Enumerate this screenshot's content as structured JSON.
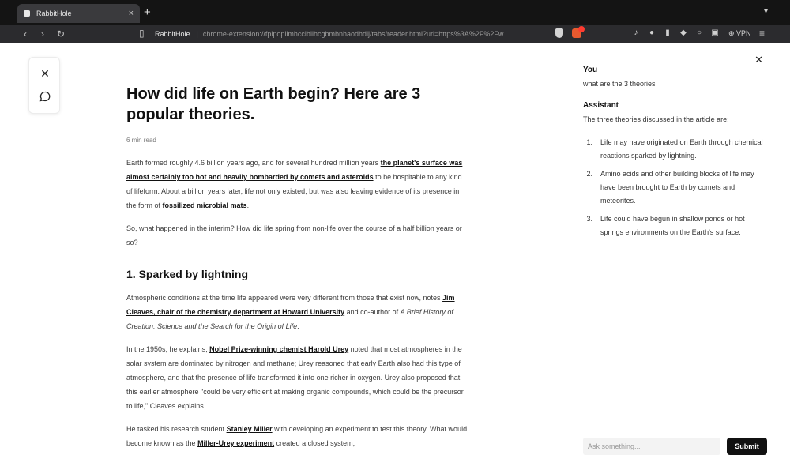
{
  "browser": {
    "tab": {
      "title": "RabbitHole",
      "close_glyph": "×"
    },
    "new_tab_glyph": "+",
    "url": {
      "site": "RabbitHole",
      "separator": "|",
      "path": "chrome-extension://fpipoplimhccibiihcgbmbnhaodhdlj/tabs/reader.html?url=https%3A%2F%2Fw..."
    },
    "vpn_label": "VPN",
    "icons": [
      "back-icon",
      "forward-icon",
      "reload-icon",
      "bookmark-icon",
      "brave-shield-icon",
      "brave-rewards-icon",
      "extension-icon",
      "menu-icon"
    ]
  },
  "reader": {
    "tools": {
      "close_icon": "✕",
      "chat_icon": "💬"
    },
    "article": {
      "title": "How did life on Earth begin? Here are 3 popular theories.",
      "read_time": "6 min read",
      "p1": {
        "t1": "Earth formed roughly 4.6 billion years ago, and for several hundred million years ",
        "l1": "the planet's surface was almost certainly too hot and heavily bombarded by comets and asteroids",
        "t2": " to be hospitable to any kind of lifeform. About a billion years later, life not only existed, but was also leaving evidence of its presence in the form of ",
        "l2": "fossilized microbial mats",
        "t3": "."
      },
      "p2": "So, what happened in the interim? How did life spring from non-life over the course of a half billion years or so?",
      "h2_1": "1. Sparked by lightning",
      "p3": {
        "t1": "Atmospheric conditions at the time life appeared were very different from those that exist now, notes ",
        "l1": "Jim Cleaves, chair of the chemistry department at Howard University",
        "t2": " and co-author of ",
        "em": "A Brief History of Creation: Science and the Search for the Origin of Life",
        "t3": "."
      },
      "p4": {
        "t1": "In the 1950s, he explains, ",
        "l1": "Nobel Prize-winning chemist Harold Urey",
        "t2": " noted that most atmospheres in the solar system are dominated by nitrogen and methane; Urey reasoned that early Earth also had this type of atmosphere, and that the presence of life transformed it into one richer in oxygen. Urey also proposed that this earlier atmosphere \"could be very efficient at making organic compounds, which could be the precursor to life,\" Cleaves explains."
      },
      "p5": {
        "t1": "He tasked his research student ",
        "l1": "Stanley Miller",
        "t2": " with developing an experiment to test this theory. What would become known as the ",
        "l2": "Miller-Urey experiment",
        "t3": " created a closed system,"
      }
    }
  },
  "panel": {
    "close_glyph": "✕",
    "user_role": "You",
    "user_message": "what are the 3 theories",
    "assistant_role": "Assistant",
    "assistant_intro": "The three theories discussed in the article are:",
    "answers": [
      {
        "num": "1.",
        "text": "Life may have originated on Earth through chemical reactions sparked by lightning."
      },
      {
        "num": "2.",
        "text": "Amino acids and other building blocks of life may have been brought to Earth by comets and meteorites."
      },
      {
        "num": "3.",
        "text": "Life could have begun in shallow ponds or hot springs environments on the Earth's surface."
      }
    ],
    "input_placeholder": "Ask something...",
    "input_value": "",
    "submit_label": "Submit"
  }
}
